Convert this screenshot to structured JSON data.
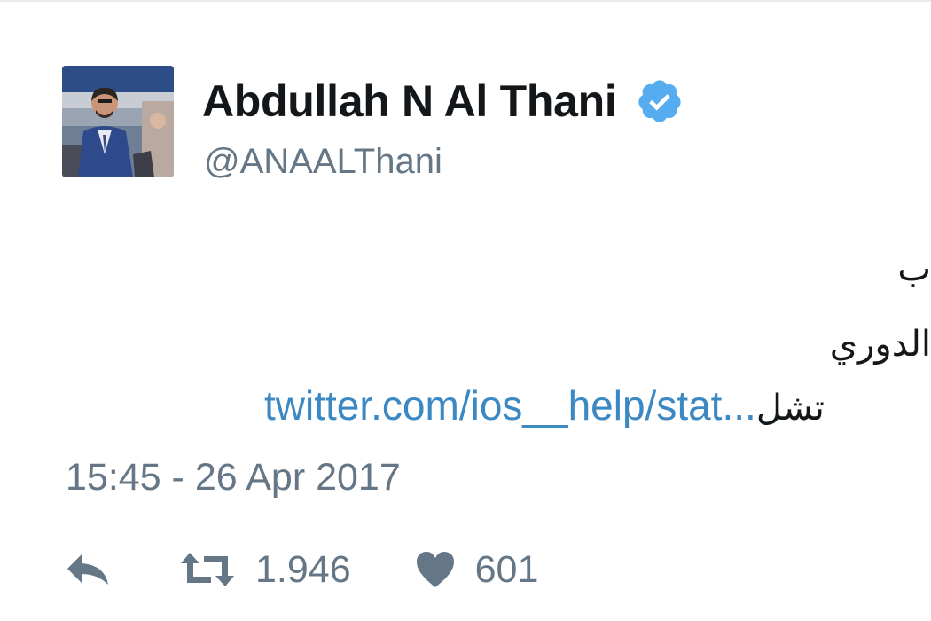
{
  "tweet": {
    "author": {
      "display_name": "Abdullah N Al Thani",
      "handle": "@ANAALThani",
      "verified": true,
      "avatar_icon": "profile-photo"
    },
    "body": {
      "line1": "ب",
      "line2": "الدوري",
      "link_text": "twitter.com/ios__help/stat",
      "ellipsis": "...",
      "line3_arabic": "تشل"
    },
    "timestamp": "15:45 - 26 Apr 2017",
    "actions": {
      "reply_icon": "reply-icon",
      "retweet_icon": "retweet-icon",
      "retweet_count": "1.946",
      "like_icon": "heart-icon",
      "like_count": "601"
    }
  },
  "colors": {
    "text": "#14171a",
    "secondary": "#657786",
    "link": "#3b88c3",
    "verified": "#55acee",
    "border": "#e6ecf0"
  }
}
